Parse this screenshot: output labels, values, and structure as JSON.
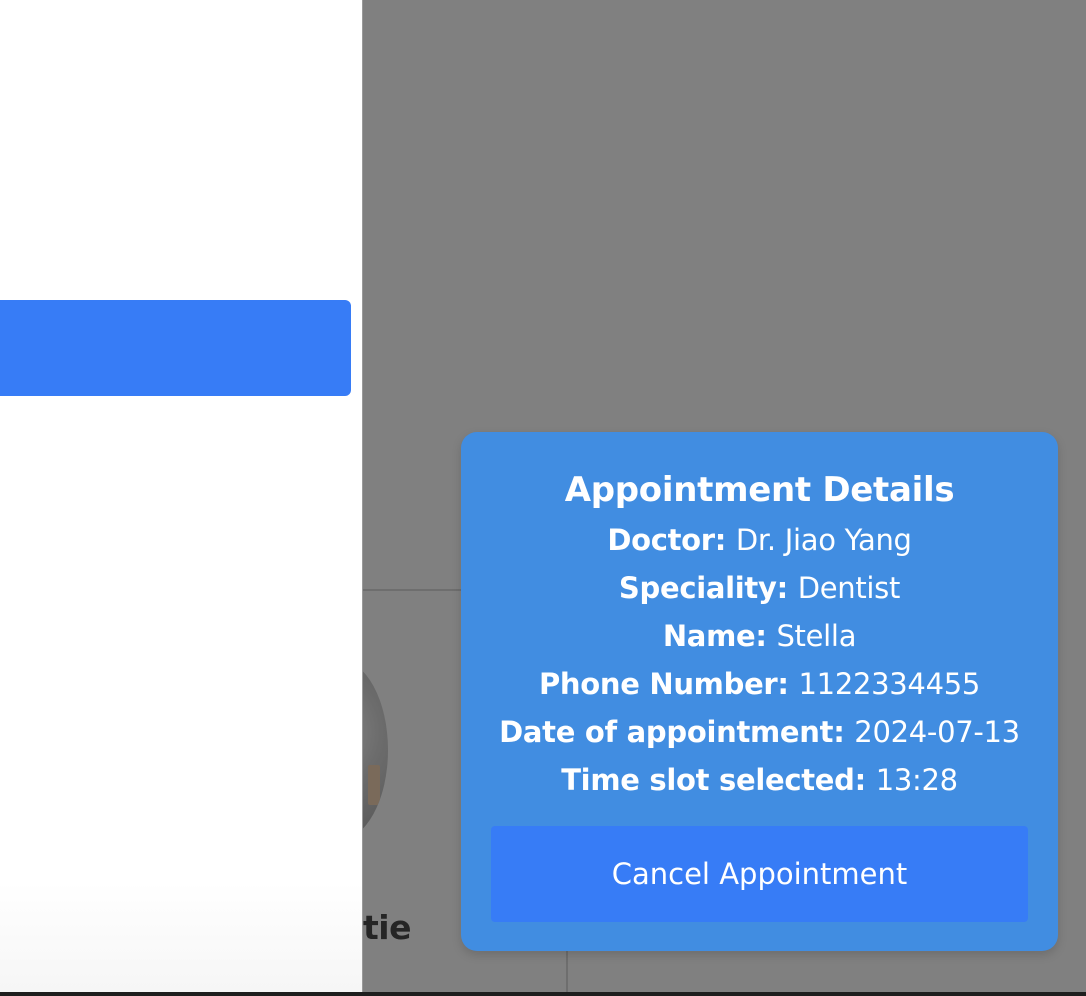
{
  "background": {
    "doctor_name_fragment": "tie"
  },
  "popup": {
    "title": "Appointment Details",
    "details": [
      {
        "label": "Doctor:",
        "value": "Dr. Jiao Yang"
      },
      {
        "label": "Speciality:",
        "value": "Dentist"
      },
      {
        "label": "Name:",
        "value": "Stella"
      },
      {
        "label": "Phone Number:",
        "value": "1122334455"
      },
      {
        "label": "Date of appointment:",
        "value": "2024-07-13"
      },
      {
        "label": "Time slot selected:",
        "value": "13:28"
      }
    ],
    "cancel_label": "Cancel Appointment"
  },
  "colors": {
    "overlay": "#808080",
    "popup_bg": "#418de1",
    "button_bg": "#377cf6",
    "text": "#ffffff"
  }
}
